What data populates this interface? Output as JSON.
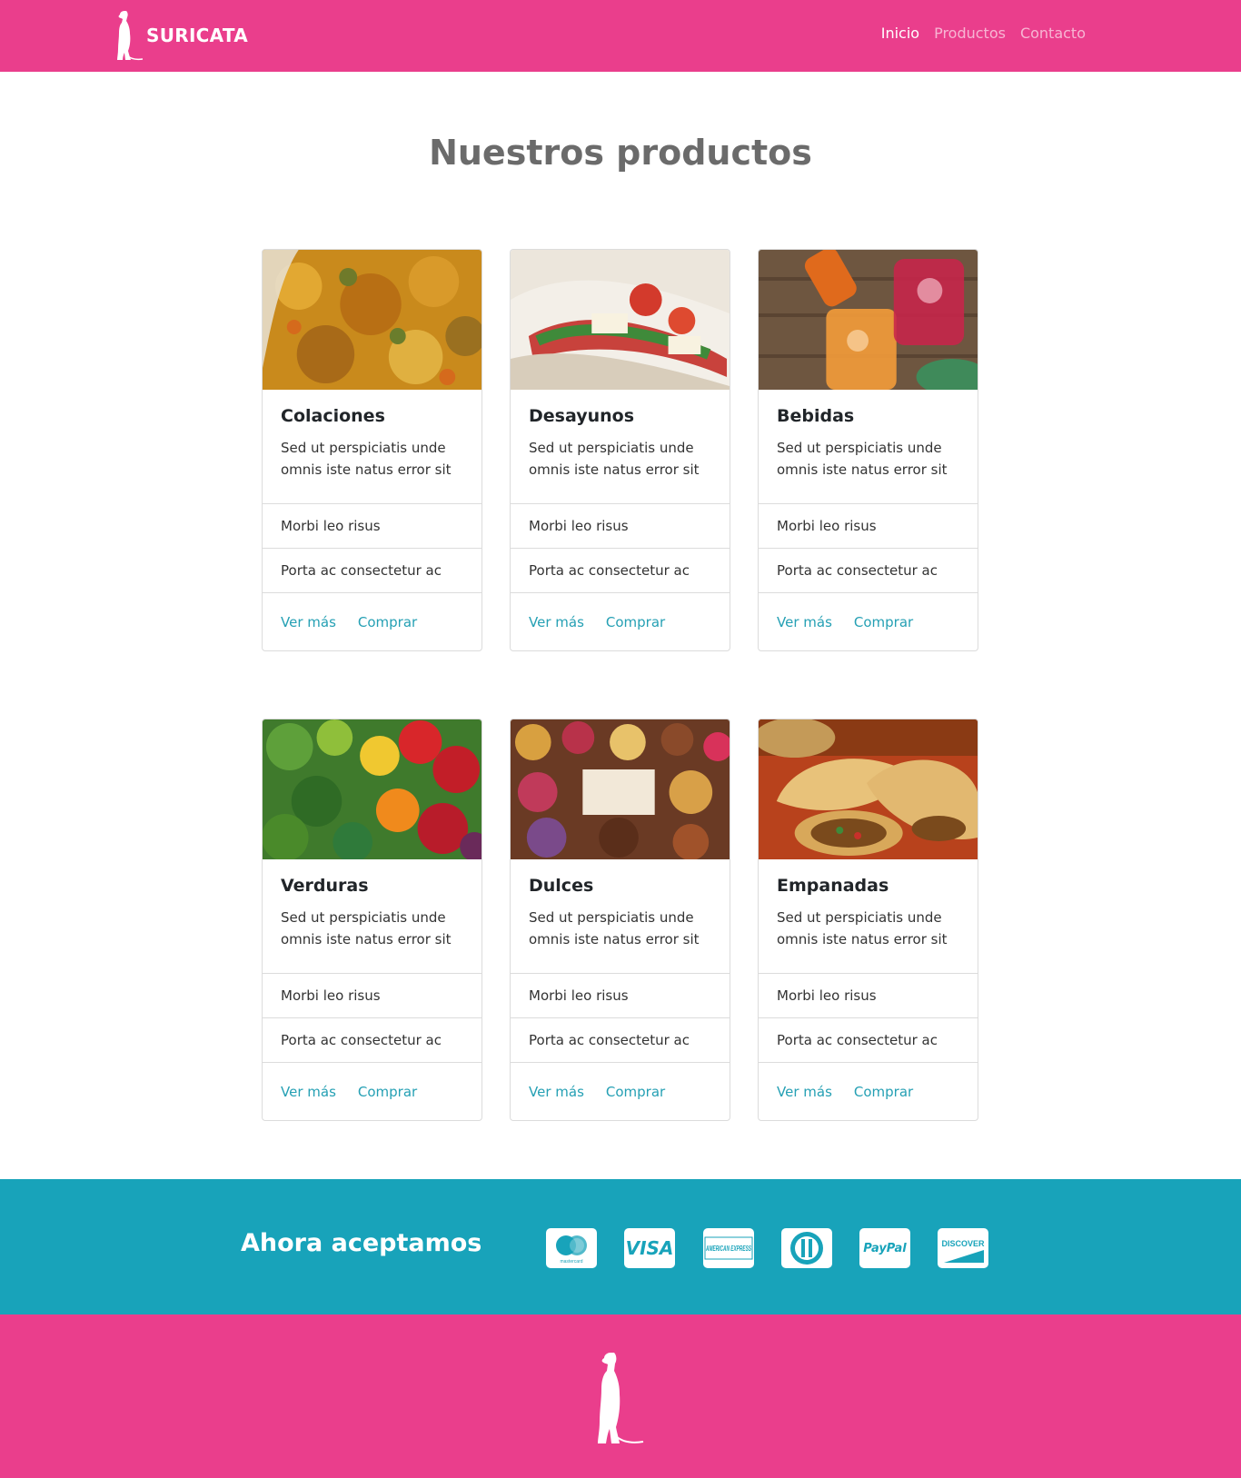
{
  "navbar": {
    "brand": "SURICATA",
    "links": [
      "Inicio",
      "Productos",
      "Contacto"
    ],
    "active_index": 0
  },
  "main": {
    "title": "Nuestros productos",
    "cards": [
      {
        "title": "Colaciones",
        "text": "Sed ut perspiciatis unde omnis iste natus error sit",
        "items": [
          "Morbi leo risus",
          "Porta ac consectetur ac"
        ],
        "link1": "Ver más",
        "link2": "Comprar"
      },
      {
        "title": "Desayunos",
        "text": "Sed ut perspiciatis unde omnis iste natus error sit",
        "items": [
          "Morbi leo risus",
          "Porta ac consectetur ac"
        ],
        "link1": "Ver más",
        "link2": "Comprar"
      },
      {
        "title": "Bebidas",
        "text": "Sed ut perspiciatis unde omnis iste natus error sit",
        "items": [
          "Morbi leo risus",
          "Porta ac consectetur ac"
        ],
        "link1": "Ver más",
        "link2": "Comprar"
      },
      {
        "title": "Verduras",
        "text": "Sed ut perspiciatis unde omnis iste natus error sit",
        "items": [
          "Morbi leo risus",
          "Porta ac consectetur ac"
        ],
        "link1": "Ver más",
        "link2": "Comprar"
      },
      {
        "title": "Dulces",
        "text": "Sed ut perspiciatis unde omnis iste natus error sit",
        "items": [
          "Morbi leo risus",
          "Porta ac consectetur ac"
        ],
        "link1": "Ver más",
        "link2": "Comprar"
      },
      {
        "title": "Empanadas",
        "text": "Sed ut perspiciatis unde omnis iste natus error sit",
        "items": [
          "Morbi leo risus",
          "Porta ac consectetur ac"
        ],
        "link1": "Ver más",
        "link2": "Comprar"
      }
    ]
  },
  "payments": {
    "title": "Ahora aceptamos",
    "methods": [
      {
        "icon": "mastercard-icon",
        "label": "mastercard"
      },
      {
        "icon": "visa-icon",
        "label": "VISA"
      },
      {
        "icon": "amex-icon",
        "label": "AMERICAN EXPRESS"
      },
      {
        "icon": "diners-icon",
        "label": ""
      },
      {
        "icon": "paypal-icon",
        "label": "PayPal"
      },
      {
        "icon": "discover-icon",
        "label": "DISCOVER"
      }
    ]
  },
  "colors": {
    "brand_pink": "#ea3e8c",
    "accent_teal": "#18a3ba",
    "link_teal": "#25a0b4",
    "title_gray": "#6b6b6b"
  }
}
